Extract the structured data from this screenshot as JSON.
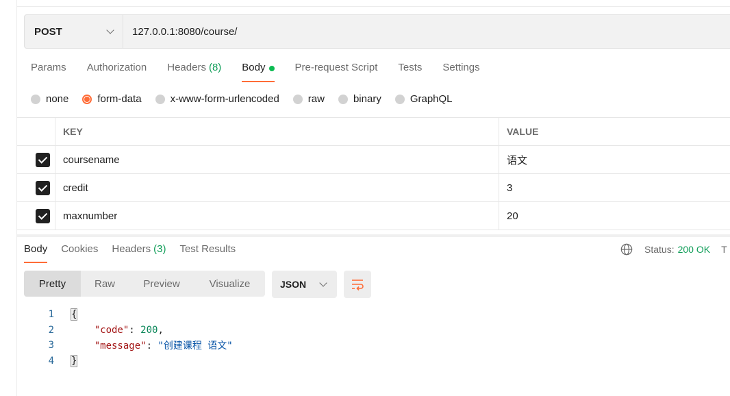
{
  "request": {
    "method": "POST",
    "url": "127.0.0.1:8080/course/"
  },
  "request_tabs": [
    {
      "label": "Params"
    },
    {
      "label": "Authorization"
    },
    {
      "label": "Headers",
      "count": "(8)"
    },
    {
      "label": "Body",
      "active": true
    },
    {
      "label": "Pre-request Script"
    },
    {
      "label": "Tests"
    },
    {
      "label": "Settings"
    }
  ],
  "body_types": [
    {
      "label": "none"
    },
    {
      "label": "form-data",
      "selected": true
    },
    {
      "label": "x-www-form-urlencoded"
    },
    {
      "label": "raw"
    },
    {
      "label": "binary"
    },
    {
      "label": "GraphQL"
    }
  ],
  "form_table": {
    "key_header": "KEY",
    "value_header": "VALUE",
    "rows": [
      {
        "key": "coursename",
        "value": "语文",
        "checked": true
      },
      {
        "key": "credit",
        "value": "3",
        "checked": true
      },
      {
        "key": "maxnumber",
        "value": "20",
        "checked": true
      }
    ]
  },
  "response_tabs": [
    {
      "label": "Body",
      "active": true
    },
    {
      "label": "Cookies"
    },
    {
      "label": "Headers",
      "count": "(3)"
    },
    {
      "label": "Test Results"
    }
  ],
  "response_status": {
    "label": "Status:",
    "value": "200 OK",
    "truncated": "T"
  },
  "view_modes": [
    "Pretty",
    "Raw",
    "Preview",
    "Visualize"
  ],
  "format": "JSON",
  "code_lines": [
    {
      "n": "1"
    },
    {
      "n": "2"
    },
    {
      "n": "3"
    },
    {
      "n": "4"
    }
  ],
  "response_json": {
    "key_code": "\"code\"",
    "val_code": "200",
    "key_message": "\"message\"",
    "val_message": "\"创建课程 语文\""
  },
  "colors": {
    "accent": "#ff6c37",
    "success": "#0f9d58",
    "body_dot": "#0cbb52"
  }
}
